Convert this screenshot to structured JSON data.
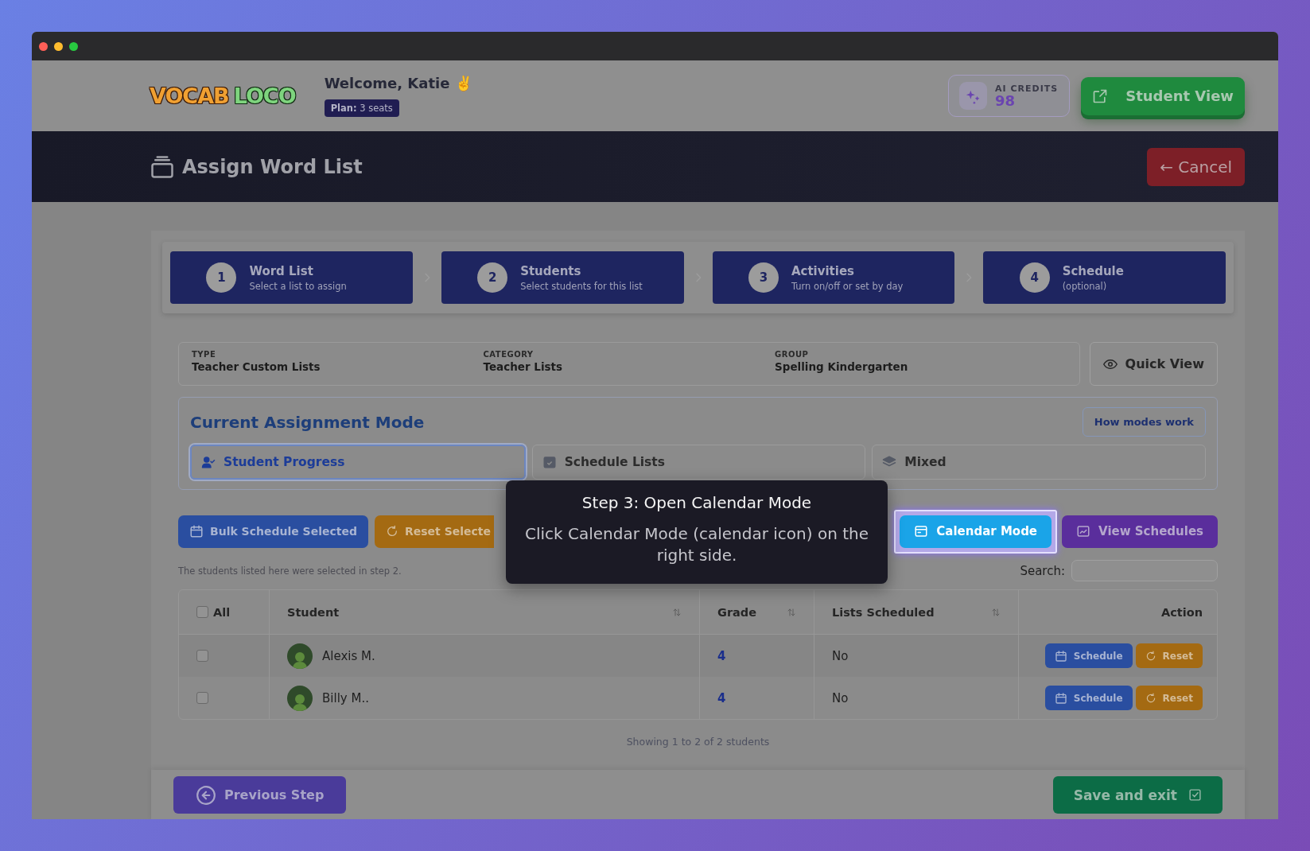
{
  "window": {
    "controls": [
      {
        "color": "#ff5f57"
      },
      {
        "color": "#febc2e"
      },
      {
        "color": "#28c840"
      }
    ]
  },
  "header": {
    "logo": [
      "VOCAB",
      "LOCO"
    ],
    "welcome": "Welcome, Katie ✌️",
    "plan": {
      "label": "Plan:",
      "value": "3 seats"
    },
    "ai_credits": {
      "label": "AI CREDITS",
      "value": "98"
    },
    "student_view_button": "Student View"
  },
  "page_title": {
    "title": "Assign Word List",
    "cancel_button": "← Cancel"
  },
  "steps": [
    {
      "number": "1",
      "title": "Word List",
      "subtitle": "Select a list to assign"
    },
    {
      "number": "2",
      "title": "Students",
      "subtitle": "Select students for this list"
    },
    {
      "number": "3",
      "title": "Activities",
      "subtitle": "Turn on/off or set by day"
    },
    {
      "number": "4",
      "title": "Schedule",
      "subtitle": "(optional)"
    }
  ],
  "list_info": {
    "fields": [
      {
        "label": "TYPE",
        "value": "Teacher Custom Lists"
      },
      {
        "label": "CATEGORY",
        "value": "Teacher Lists"
      },
      {
        "label": "GROUP",
        "value": "Spelling Kindergarten"
      }
    ],
    "quick_view_button": "Quick View"
  },
  "assignment_mode": {
    "title": "Current Assignment Mode",
    "help_button": "How modes work",
    "modes": [
      {
        "label": "Student Progress",
        "kind": "progress",
        "selected": true
      },
      {
        "label": "Schedule Lists",
        "kind": "schedule",
        "selected": false
      },
      {
        "label": "Mixed",
        "kind": "mixed",
        "selected": false
      }
    ]
  },
  "actions": {
    "left": [
      {
        "label": "Bulk Schedule Selected",
        "kind": "bulk"
      },
      {
        "label": "Reset Selecte",
        "kind": "reset"
      }
    ],
    "right": [
      {
        "label": "Calendar Mode",
        "kind": "calendar",
        "highlighted": true
      },
      {
        "label": "View Schedules",
        "kind": "schedules",
        "highlighted": false
      }
    ]
  },
  "note": "The students listed here were selected in step 2.",
  "search": {
    "label": "Search:"
  },
  "table": {
    "columns": [
      {
        "label": "All",
        "kind": "check",
        "sortable": false,
        "checked": false
      },
      {
        "label": "Student",
        "kind": "text",
        "sortable": true
      },
      {
        "label": "Grade",
        "kind": "text",
        "sortable": true
      },
      {
        "label": "Lists Scheduled",
        "kind": "text",
        "sortable": true
      },
      {
        "label": "Action",
        "kind": "action",
        "sortable": false
      }
    ],
    "rows": [
      {
        "checked": false,
        "student": "Alexis M.",
        "grade": "4",
        "lists_scheduled": "No",
        "actions": [
          {
            "label": "Schedule",
            "kind": "schedule"
          },
          {
            "label": "Reset",
            "kind": "reset"
          }
        ]
      },
      {
        "checked": false,
        "student": "Billy M..",
        "grade": "4",
        "lists_scheduled": "No",
        "actions": [
          {
            "label": "Schedule",
            "kind": "schedule"
          },
          {
            "label": "Reset",
            "kind": "reset"
          }
        ]
      }
    ],
    "footer": "Showing 1 to 2 of 2 students"
  },
  "tour": {
    "title": "Step 3: Open Calendar Mode",
    "body": "Click Calendar Mode (calendar icon) on the right side."
  },
  "footer": {
    "previous_button": "Previous Step",
    "save_button": "Save and exit"
  }
}
